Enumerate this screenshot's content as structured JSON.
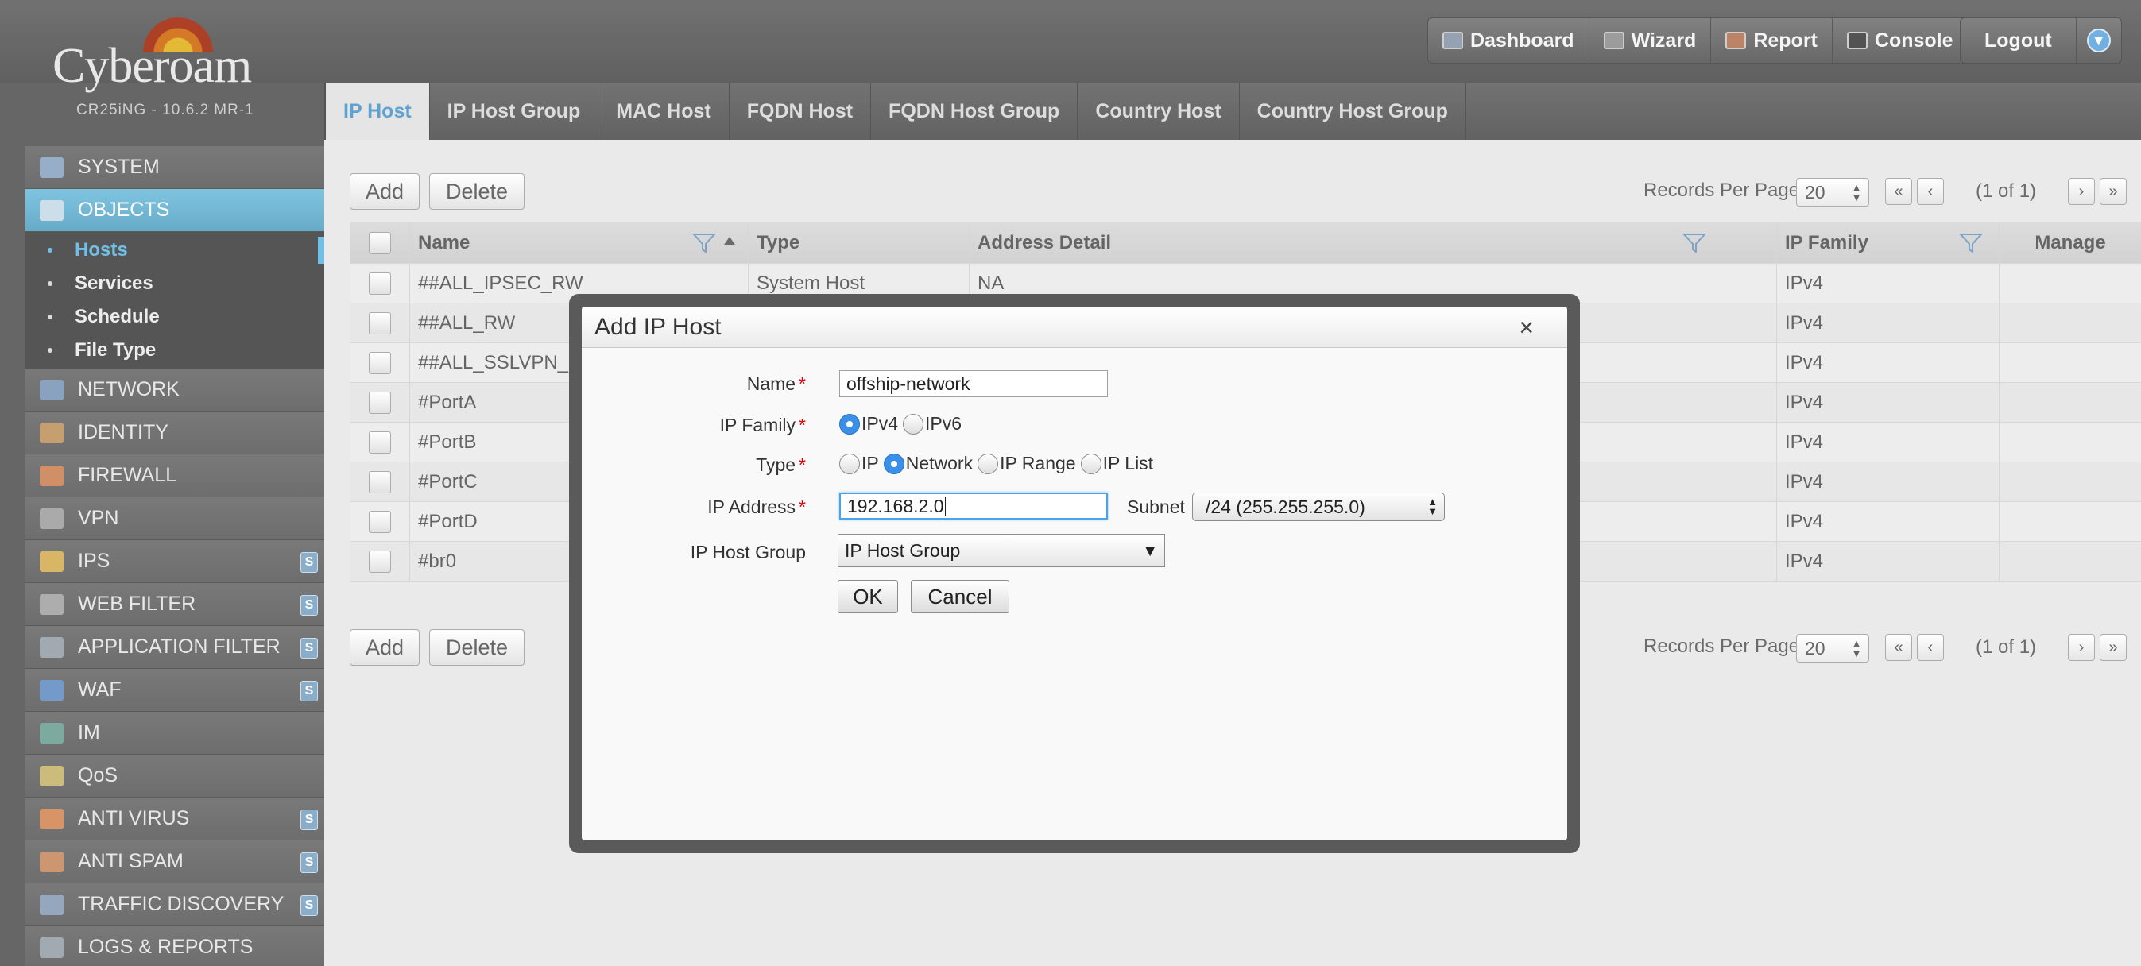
{
  "brand": {
    "name": "Cyberoam",
    "version": "CR25iNG - 10.6.2 MR-1"
  },
  "topnav": {
    "items": [
      {
        "label": "Dashboard",
        "icon": "dashboard-icon"
      },
      {
        "label": "Wizard",
        "icon": "wizard-icon"
      },
      {
        "label": "Report",
        "icon": "report-icon"
      },
      {
        "label": "Console",
        "icon": "console-icon"
      }
    ],
    "logout": "Logout"
  },
  "sidebar": {
    "menu_before": [
      {
        "label": "SYSTEM",
        "icon": "system-icon",
        "badge": ""
      },
      {
        "label": "OBJECTS",
        "icon": "objects-icon",
        "badge": ""
      }
    ],
    "submenu": [
      "Hosts",
      "Services",
      "Schedule",
      "File Type"
    ],
    "menu_after": [
      {
        "label": "NETWORK",
        "icon": "network-icon",
        "badge": ""
      },
      {
        "label": "IDENTITY",
        "icon": "identity-icon",
        "badge": ""
      },
      {
        "label": "FIREWALL",
        "icon": "firewall-icon",
        "badge": ""
      },
      {
        "label": "VPN",
        "icon": "vpn-icon",
        "badge": ""
      },
      {
        "label": "IPS",
        "icon": "ips-icon",
        "badge": "S"
      },
      {
        "label": "WEB FILTER",
        "icon": "web-filter-icon",
        "badge": "S"
      },
      {
        "label": "APPLICATION FILTER",
        "icon": "application-filter-icon",
        "badge": "S"
      },
      {
        "label": "WAF",
        "icon": "waf-icon",
        "badge": "S"
      },
      {
        "label": "IM",
        "icon": "im-icon",
        "badge": ""
      },
      {
        "label": "QoS",
        "icon": "qos-icon",
        "badge": ""
      },
      {
        "label": "ANTI VIRUS",
        "icon": "anti-virus-icon",
        "badge": "S"
      },
      {
        "label": "ANTI SPAM",
        "icon": "anti-spam-icon",
        "badge": "S"
      },
      {
        "label": "TRAFFIC DISCOVERY",
        "icon": "traffic-discovery-icon",
        "badge": "S"
      },
      {
        "label": "LOGS & REPORTS",
        "icon": "logs-reports-icon",
        "badge": ""
      }
    ]
  },
  "tabs": [
    "IP Host",
    "IP Host Group",
    "MAC Host",
    "FQDN Host",
    "FQDN Host Group",
    "Country Host",
    "Country Host Group"
  ],
  "toolbar": {
    "add": "Add",
    "delete": "Delete",
    "records_label": "Records Per Page",
    "records_value": "20",
    "first": "«",
    "prev": "‹",
    "next": "›",
    "last": "»",
    "page_info": "(1 of 1)"
  },
  "table": {
    "headers": {
      "name": "Name",
      "type": "Type",
      "address": "Address Detail",
      "family": "IP Family",
      "manage": "Manage"
    },
    "rows": [
      {
        "name": "##ALL_IPSEC_RW",
        "type": "System Host",
        "address": "NA",
        "family": "IPv4"
      },
      {
        "name": "##ALL_RW",
        "type": "",
        "address": "",
        "family": "IPv4"
      },
      {
        "name": "##ALL_SSLVPN_RW",
        "type": "",
        "address": "",
        "family": "IPv4"
      },
      {
        "name": "#PortA",
        "type": "",
        "address": "",
        "family": "IPv4"
      },
      {
        "name": "#PortB",
        "type": "",
        "address": "",
        "family": "IPv4"
      },
      {
        "name": "#PortC",
        "type": "",
        "address": "",
        "family": "IPv4"
      },
      {
        "name": "#PortD",
        "type": "",
        "address": "",
        "family": "IPv4"
      },
      {
        "name": "#br0",
        "type": "",
        "address": "",
        "family": "IPv4"
      }
    ]
  },
  "dialog": {
    "title": "Add IP Host",
    "close": "×",
    "name_label": "Name",
    "name_value": "offship-network",
    "family_label": "IP Family",
    "family_options": [
      "IPv4",
      "IPv6"
    ],
    "family_selected": "IPv4",
    "type_label": "Type",
    "type_options": [
      "IP",
      "Network",
      "IP Range",
      "IP List"
    ],
    "type_selected": "Network",
    "ip_label": "IP Address",
    "ip_value": "192.168.2.0",
    "subnet_label": "Subnet",
    "subnet_value": "/24 (255.255.255.0)",
    "group_label": "IP Host Group",
    "group_value": "IP Host Group",
    "ok": "OK",
    "cancel": "Cancel",
    "required_mark": "*"
  },
  "colors": {
    "accent": "#3aa7dd",
    "active_menu": "#3f9dc6",
    "required": "#dd0000",
    "radio_on": "#3a90e8"
  }
}
